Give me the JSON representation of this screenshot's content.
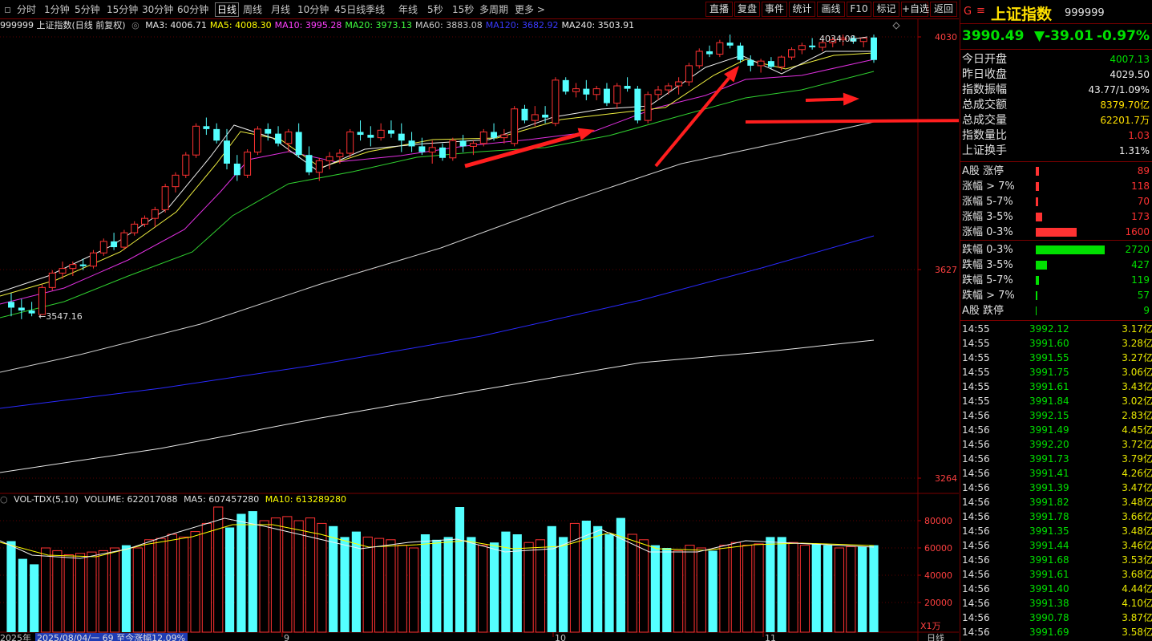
{
  "toolbar": {
    "periods": [
      "分时",
      "1分钟",
      "5分钟",
      "15分钟",
      "30分钟",
      "60分钟",
      "日线",
      "周线",
      "月线",
      "10分钟",
      "45日线",
      "季线",
      "年线",
      "5秒",
      "15秒",
      "多周期",
      "更多 >"
    ],
    "active_period": "日线",
    "buttons": [
      "直播",
      "复盘",
      "事件",
      "统计",
      "画线",
      "F10",
      "标记",
      "+自选",
      "返回"
    ]
  },
  "legend": {
    "title": "999999 上证指数(日线 前复权)",
    "ma": [
      {
        "label": "MA3: 4006.71",
        "color": "#e8e8e8"
      },
      {
        "label": "MA5: 4008.30",
        "color": "#ffff00"
      },
      {
        "label": "MA10: 3995.28",
        "color": "#ff40ff"
      },
      {
        "label": "MA20: 3973.13",
        "color": "#40ff40"
      },
      {
        "label": "MA60: 3883.08",
        "color": "#c8c8c8"
      },
      {
        "label": "MA120: 3682.92",
        "color": "#3a3aff"
      },
      {
        "label": "MA240: 3503.91",
        "color": "#e8e8e8"
      }
    ]
  },
  "vol_legend": {
    "title": "VOL-TDX(5,10)",
    "volume": "VOLUME: 622017088",
    "ma5": "MA5: 607457280",
    "ma10": "MA10: 613289280"
  },
  "price_axis": {
    "labels": [
      "4030",
      "3627",
      "3264"
    ],
    "ylim": [
      3264,
      4030
    ]
  },
  "vol_axis": {
    "labels": [
      "80000",
      "60000",
      "40000",
      "20000"
    ],
    "unit": "X1万"
  },
  "price_annotations": {
    "high": "4034.08",
    "low": "3547.16"
  },
  "bottom_bar": {
    "year": "2025年",
    "range_info": "2025/08/04/一 69 至今涨幅12.09%",
    "months": [
      "9",
      "10",
      "11"
    ],
    "period_right": "日线"
  },
  "chart_data": {
    "type": "candlestick",
    "ylim": [
      3264,
      4030
    ],
    "candles": [
      [
        3570,
        3585,
        3545,
        3560
      ],
      [
        3560,
        3575,
        3540,
        3555
      ],
      [
        3555,
        3570,
        3545,
        3550
      ],
      [
        3548,
        3600,
        3547,
        3595
      ],
      [
        3595,
        3625,
        3590,
        3620
      ],
      [
        3620,
        3640,
        3610,
        3628
      ],
      [
        3628,
        3640,
        3615,
        3635
      ],
      [
        3635,
        3645,
        3625,
        3632
      ],
      [
        3632,
        3660,
        3628,
        3655
      ],
      [
        3655,
        3680,
        3650,
        3675
      ],
      [
        3675,
        3690,
        3660,
        3665
      ],
      [
        3665,
        3695,
        3660,
        3690
      ],
      [
        3690,
        3710,
        3685,
        3705
      ],
      [
        3705,
        3720,
        3700,
        3715
      ],
      [
        3715,
        3735,
        3700,
        3730
      ],
      [
        3730,
        3775,
        3725,
        3770
      ],
      [
        3770,
        3795,
        3760,
        3790
      ],
      [
        3790,
        3830,
        3785,
        3825
      ],
      [
        3825,
        3880,
        3820,
        3875
      ],
      [
        3875,
        3890,
        3860,
        3870
      ],
      [
        3870,
        3880,
        3845,
        3850
      ],
      [
        3850,
        3870,
        3800,
        3810
      ],
      [
        3810,
        3825,
        3780,
        3790
      ],
      [
        3790,
        3835,
        3785,
        3830
      ],
      [
        3830,
        3875,
        3825,
        3870
      ],
      [
        3870,
        3880,
        3850,
        3862
      ],
      [
        3862,
        3875,
        3840,
        3845
      ],
      [
        3845,
        3870,
        3830,
        3865
      ],
      [
        3865,
        3880,
        3820,
        3825
      ],
      [
        3825,
        3840,
        3790,
        3795
      ],
      [
        3795,
        3820,
        3780,
        3815
      ],
      [
        3815,
        3830,
        3800,
        3822
      ],
      [
        3822,
        3835,
        3810,
        3828
      ],
      [
        3828,
        3870,
        3820,
        3865
      ],
      [
        3865,
        3885,
        3850,
        3860
      ],
      [
        3860,
        3875,
        3840,
        3855
      ],
      [
        3855,
        3880,
        3850,
        3868
      ],
      [
        3868,
        3885,
        3855,
        3862
      ],
      [
        3862,
        3880,
        3830,
        3850
      ],
      [
        3850,
        3865,
        3830,
        3840
      ],
      [
        3840,
        3855,
        3825,
        3830
      ],
      [
        3830,
        3850,
        3810,
        3838
      ],
      [
        3838,
        3845,
        3815,
        3820
      ],
      [
        3820,
        3855,
        3815,
        3850
      ],
      [
        3850,
        3860,
        3830,
        3840
      ],
      [
        3840,
        3850,
        3825,
        3845
      ],
      [
        3845,
        3870,
        3840,
        3865
      ],
      [
        3865,
        3880,
        3850,
        3855
      ],
      [
        3855,
        3870,
        3845,
        3860
      ],
      [
        3845,
        3910,
        3840,
        3905
      ],
      [
        3905,
        3912,
        3880,
        3885
      ],
      [
        3885,
        3910,
        3875,
        3895
      ],
      [
        3895,
        3910,
        3880,
        3890
      ],
      [
        3880,
        3960,
        3875,
        3955
      ],
      [
        3955,
        3960,
        3930,
        3935
      ],
      [
        3935,
        3950,
        3925,
        3940
      ],
      [
        3940,
        3955,
        3920,
        3930
      ],
      [
        3930,
        3945,
        3920,
        3940
      ],
      [
        3940,
        3950,
        3910,
        3915
      ],
      [
        3915,
        3950,
        3905,
        3945
      ],
      [
        3945,
        3960,
        3935,
        3940
      ],
      [
        3940,
        3945,
        3880,
        3885
      ],
      [
        3885,
        3935,
        3880,
        3930
      ],
      [
        3930,
        3945,
        3920,
        3938
      ],
      [
        3938,
        3950,
        3930,
        3945
      ],
      [
        3945,
        3960,
        3930,
        3952
      ],
      [
        3952,
        3985,
        3945,
        3980
      ],
      [
        3980,
        4010,
        3975,
        4005
      ],
      [
        4005,
        4015,
        3995,
        4000
      ],
      [
        4000,
        4025,
        3995,
        4020
      ],
      [
        4020,
        4034,
        4010,
        4015
      ],
      [
        4015,
        4020,
        3985,
        3990
      ],
      [
        3990,
        3998,
        3970,
        3980
      ],
      [
        3980,
        3992,
        3968,
        3988
      ],
      [
        3988,
        3995,
        3975,
        3978
      ],
      [
        3978,
        3998,
        3972,
        3995
      ],
      [
        3995,
        4012,
        3990,
        4008
      ],
      [
        4008,
        4020,
        4000,
        4015
      ],
      [
        4015,
        4028,
        4008,
        4012
      ],
      [
        4012,
        4025,
        4005,
        4020
      ],
      [
        4020,
        4030,
        4012,
        4025
      ],
      [
        4025,
        4034,
        4015,
        4028
      ],
      [
        4028,
        4032,
        4018,
        4022
      ],
      [
        4022,
        4030,
        4012,
        4028
      ],
      [
        4029,
        4034,
        3985,
        3990
      ]
    ],
    "volumes": [
      [
        65000,
        "down"
      ],
      [
        52000,
        "down"
      ],
      [
        48000,
        "down"
      ],
      [
        60000,
        "up"
      ],
      [
        58000,
        "up"
      ],
      [
        55000,
        "up"
      ],
      [
        56000,
        "up"
      ],
      [
        57000,
        "up"
      ],
      [
        58000,
        "up"
      ],
      [
        60000,
        "up"
      ],
      [
        62000,
        "down"
      ],
      [
        60000,
        "up"
      ],
      [
        66000,
        "up"
      ],
      [
        67000,
        "up"
      ],
      [
        70000,
        "up"
      ],
      [
        68000,
        "up"
      ],
      [
        72000,
        "up"
      ],
      [
        78000,
        "up"
      ],
      [
        90000,
        "up"
      ],
      [
        75000,
        "down"
      ],
      [
        85000,
        "down"
      ],
      [
        87000,
        "down"
      ],
      [
        80000,
        "up"
      ],
      [
        82000,
        "up"
      ],
      [
        83000,
        "up"
      ],
      [
        80000,
        "up"
      ],
      [
        82000,
        "up"
      ],
      [
        78000,
        "up"
      ],
      [
        76000,
        "down"
      ],
      [
        68000,
        "down"
      ],
      [
        72000,
        "down"
      ],
      [
        68000,
        "up"
      ],
      [
        67000,
        "up"
      ],
      [
        66000,
        "up"
      ],
      [
        62000,
        "up"
      ],
      [
        60000,
        "up"
      ],
      [
        70000,
        "down"
      ],
      [
        66000,
        "down"
      ],
      [
        68000,
        "down"
      ],
      [
        90000,
        "down"
      ],
      [
        68000,
        "down"
      ],
      [
        62000,
        "up"
      ],
      [
        64000,
        "down"
      ],
      [
        72000,
        "down"
      ],
      [
        70000,
        "down"
      ],
      [
        64000,
        "up"
      ],
      [
        66000,
        "up"
      ],
      [
        76000,
        "down"
      ],
      [
        68000,
        "down"
      ],
      [
        78000,
        "up"
      ],
      [
        80000,
        "down"
      ],
      [
        76000,
        "down"
      ],
      [
        70000,
        "down"
      ],
      [
        82000,
        "down"
      ],
      [
        70000,
        "up"
      ],
      [
        66000,
        "up"
      ],
      [
        62000,
        "down"
      ],
      [
        60000,
        "down"
      ],
      [
        58000,
        "up"
      ],
      [
        62000,
        "up"
      ],
      [
        60000,
        "up"
      ],
      [
        58000,
        "down"
      ],
      [
        62000,
        "up"
      ],
      [
        64000,
        "up"
      ],
      [
        62000,
        "up"
      ],
      [
        63000,
        "up"
      ],
      [
        68000,
        "down"
      ],
      [
        68000,
        "down"
      ],
      [
        64000,
        "up"
      ],
      [
        62000,
        "up"
      ],
      [
        63000,
        "down"
      ],
      [
        62000,
        "down"
      ],
      [
        60000,
        "up"
      ],
      [
        61000,
        "up"
      ],
      [
        61000,
        "down"
      ],
      [
        62000,
        "down"
      ]
    ],
    "arrows": [
      {
        "from": [
          580,
          183
        ],
        "to": [
          742,
          138
        ],
        "width": 5
      },
      {
        "from": [
          818,
          183
        ],
        "to": [
          922,
          58
        ],
        "width": 4
      },
      {
        "from": [
          1005,
          101
        ],
        "to": [
          1072,
          99
        ],
        "width": 4
      },
      {
        "from": [
          930,
          128
        ],
        "to": [
          1226,
          126
        ],
        "width": 4
      }
    ]
  },
  "panel": {
    "header": {
      "flag": "G",
      "menu": "≡",
      "name": "上证指数",
      "code": "999999"
    },
    "quote": {
      "price": "3990.49",
      "change": "▼-39.01",
      "pct": "-0.97%"
    },
    "stats": [
      {
        "label": "今日开盘",
        "value": "4007.13",
        "color": "green"
      },
      {
        "label": "昨日收盘",
        "value": "4029.50",
        "color": "white"
      },
      {
        "label": "指数振幅",
        "value": "43.77/1.09%",
        "color": "white"
      },
      {
        "label": "总成交额",
        "value": "8379.70亿",
        "color": "yellow"
      },
      {
        "label": "总成交量",
        "value": "62201.7万",
        "color": "yellow"
      },
      {
        "label": "指数量比",
        "value": "1.03",
        "color": "red"
      },
      {
        "label": "上证换手",
        "value": "1.31%",
        "color": "white"
      }
    ],
    "breadth_up": [
      {
        "label": "A股 涨停",
        "value": "89",
        "bar": 0.05
      },
      {
        "label": "涨幅 > 7%",
        "value": "118",
        "bar": 0.05
      },
      {
        "label": "涨幅 5-7%",
        "value": "70",
        "bar": 0.04
      },
      {
        "label": "涨幅 3-5%",
        "value": "173",
        "bar": 0.09
      },
      {
        "label": "涨幅 0-3%",
        "value": "1600",
        "bar": 0.59
      }
    ],
    "breadth_down": [
      {
        "label": "跌幅 0-3%",
        "value": "2720",
        "bar": 1.0
      },
      {
        "label": "跌幅 3-5%",
        "value": "427",
        "bar": 0.16
      },
      {
        "label": "跌幅 5-7%",
        "value": "119",
        "bar": 0.05
      },
      {
        "label": "跌幅 > 7%",
        "value": "57",
        "bar": 0.02
      },
      {
        "label": "A股 跌停",
        "value": "9",
        "bar": 0.01
      }
    ],
    "ticks": [
      [
        "14:55",
        "3992.12",
        "3.17亿"
      ],
      [
        "14:55",
        "3991.60",
        "3.28亿"
      ],
      [
        "14:55",
        "3991.55",
        "3.27亿"
      ],
      [
        "14:55",
        "3991.75",
        "3.06亿"
      ],
      [
        "14:55",
        "3991.61",
        "3.43亿"
      ],
      [
        "14:55",
        "3991.84",
        "3.02亿"
      ],
      [
        "14:56",
        "3992.15",
        "2.83亿"
      ],
      [
        "14:56",
        "3991.49",
        "4.45亿"
      ],
      [
        "14:56",
        "3992.20",
        "3.72亿"
      ],
      [
        "14:56",
        "3991.73",
        "3.79亿"
      ],
      [
        "14:56",
        "3991.41",
        "4.26亿"
      ],
      [
        "14:56",
        "3991.39",
        "3.47亿"
      ],
      [
        "14:56",
        "3991.82",
        "3.48亿"
      ],
      [
        "14:56",
        "3991.78",
        "3.66亿"
      ],
      [
        "14:56",
        "3991.35",
        "3.48亿"
      ],
      [
        "14:56",
        "3991.44",
        "3.46亿"
      ],
      [
        "14:56",
        "3991.68",
        "3.53亿"
      ],
      [
        "14:56",
        "3991.61",
        "3.68亿"
      ],
      [
        "14:56",
        "3991.40",
        "4.44亿"
      ],
      [
        "14:56",
        "3991.38",
        "4.10亿"
      ],
      [
        "14:56",
        "3990.78",
        "3.87亿"
      ],
      [
        "14:56",
        "3991.69",
        "3.58亿"
      ]
    ]
  }
}
